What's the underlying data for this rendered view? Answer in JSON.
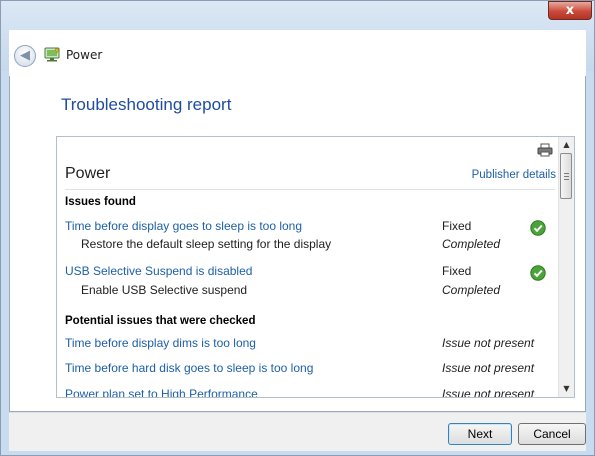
{
  "window": {
    "title": "Power",
    "close_glyph": "x",
    "back_glyph": "◀"
  },
  "report": {
    "heading": "Troubleshooting report",
    "section_title": "Power",
    "publisher_link": "Publisher details",
    "issues_found_header": "Issues found",
    "issues_found": [
      {
        "title": "Time before display goes to sleep is too long",
        "status": "Fixed",
        "detail": "Restore the default sleep setting for the display",
        "detail_status": "Completed"
      },
      {
        "title": "USB Selective Suspend is disabled",
        "status": "Fixed",
        "detail": "Enable USB Selective suspend",
        "detail_status": "Completed"
      }
    ],
    "checked_header": "Potential issues that were checked",
    "checked": [
      {
        "title": "Time before display dims is too long",
        "status": "Issue not present"
      },
      {
        "title": "Time before hard disk goes to sleep is too long",
        "status": "Issue not present"
      },
      {
        "title": "Power plan set to High Performance",
        "status": "Issue not present"
      }
    ]
  },
  "buttons": {
    "next": "Next",
    "cancel": "Cancel"
  },
  "icons": {
    "back": "back-arrow-icon",
    "app": "power-options-icon",
    "print": "printer-icon",
    "status_fixed": "green-check-icon"
  },
  "colors": {
    "link": "#1d5fa8",
    "heading": "#1f4ca0",
    "check": "#4aa43a",
    "close": "#c94a3a"
  }
}
